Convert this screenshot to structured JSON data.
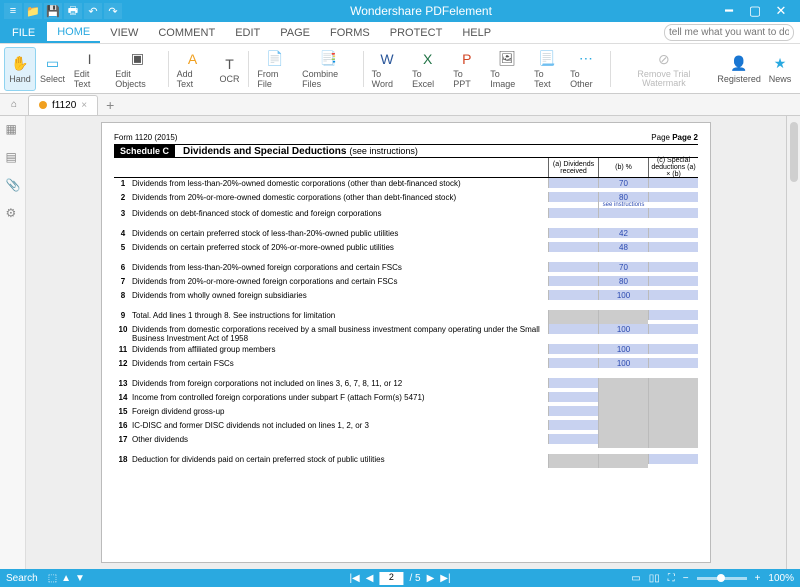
{
  "app_title": "Wondershare PDFelement",
  "menubar": {
    "file": "FILE",
    "tabs": [
      "HOME",
      "VIEW",
      "COMMENT",
      "EDIT",
      "PAGE",
      "FORMS",
      "PROTECT",
      "HELP"
    ],
    "help_placeholder": "tell me what you want to do"
  },
  "ribbon": {
    "hand": "Hand",
    "select": "Select",
    "edit_text": "Edit Text",
    "edit_objects": "Edit Objects",
    "add_text": "Add Text",
    "ocr": "OCR",
    "from_file": "From File",
    "combine": "Combine Files",
    "to_word": "To Word",
    "to_excel": "To Excel",
    "to_ppt": "To PPT",
    "to_image": "To Image",
    "to_text": "To Text",
    "to_other": "To Other",
    "remove_wm": "Remove Trial Watermark",
    "registered": "Registered",
    "news": "News"
  },
  "doc_tab": "f1120",
  "form": {
    "form_id": "Form 1120 (2015)",
    "page": "Page 2",
    "schedule": "Schedule C",
    "title": "Dividends and Special Deductions",
    "title_sub": "(see instructions)",
    "col_a": "(a) Dividends received",
    "col_b": "(b) %",
    "col_c": "(c) Special deductions (a) × (b)",
    "rows": [
      {
        "n": "1",
        "d": "Dividends from less-than-20%-owned domestic corporations (other than debt-financed stock)",
        "b": "70"
      },
      {
        "n": "2",
        "d": "Dividends from 20%-or-more-owned domestic corporations (other than debt-financed stock)",
        "b": "80",
        "see": "see instructions"
      },
      {
        "n": "3",
        "d": "Dividends on debt-financed stock of domestic and foreign corporations",
        "b": ""
      },
      {
        "n": "4",
        "d": "Dividends on certain preferred stock of less-than-20%-owned public utilities",
        "b": "42"
      },
      {
        "n": "5",
        "d": "Dividends on certain preferred stock of 20%-or-more-owned public utilities",
        "b": "48"
      },
      {
        "n": "6",
        "d": "Dividends from less-than-20%-owned foreign corporations and certain FSCs",
        "b": "70"
      },
      {
        "n": "7",
        "d": "Dividends from 20%-or-more-owned foreign corporations and certain FSCs",
        "b": "80"
      },
      {
        "n": "8",
        "d": "Dividends from wholly owned foreign subsidiaries",
        "b": "100"
      },
      {
        "n": "9",
        "d": "Total. Add lines 1 through 8. See instructions for limitation",
        "gray_a": true,
        "gray_b": true
      },
      {
        "n": "10",
        "d": "Dividends from domestic corporations received by a small business investment company operating under the Small Business Investment Act of 1958",
        "b": "100"
      },
      {
        "n": "11",
        "d": "Dividends from affiliated group members",
        "b": "100"
      },
      {
        "n": "12",
        "d": "Dividends from certain FSCs",
        "b": "100"
      },
      {
        "n": "13",
        "d": "Dividends from foreign corporations not included on lines 3, 6, 7, 8, 11, or 12",
        "gray_b": true,
        "gray_c": true
      },
      {
        "n": "14",
        "d": "Income from controlled foreign corporations under subpart F (attach Form(s) 5471)",
        "gray_b": true,
        "gray_c": true
      },
      {
        "n": "15",
        "d": "Foreign dividend gross-up",
        "gray_b": true,
        "gray_c": true
      },
      {
        "n": "16",
        "d": "IC-DISC and former DISC dividends not included on lines 1, 2, or 3",
        "gray_b": true,
        "gray_c": true
      },
      {
        "n": "17",
        "d": "Other dividends",
        "gray_b": true,
        "gray_c": true
      },
      {
        "n": "18",
        "d": "Deduction for dividends paid on certain preferred stock of public utilities",
        "gray_a": true,
        "gray_b": true
      }
    ]
  },
  "status": {
    "search": "Search",
    "page": "2",
    "total": "/ 5",
    "zoom": "100%"
  }
}
